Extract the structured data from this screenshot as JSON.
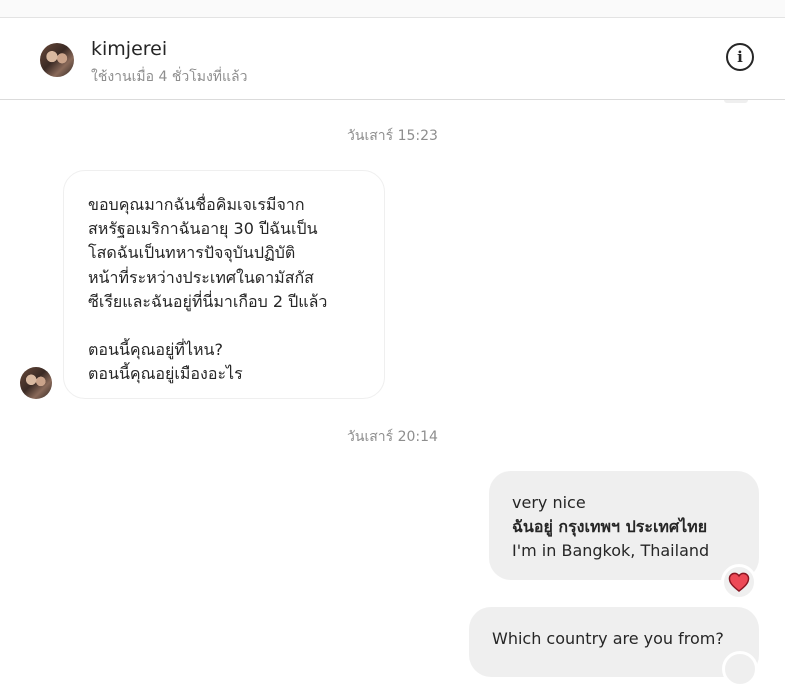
{
  "header": {
    "username": "kimjerei",
    "status": "ใช้งานเมื่อ 4 ชั่วโมงที่แล้ว",
    "info_icon": "info-icon"
  },
  "messages": {
    "timestamp1": "วันเสาร์ 15:23",
    "incoming_lines": [
      "ขอบคุณมากฉันชื่อคิมเจเรมีจาก",
      "สหรัฐอเมริกาฉันอายุ 30 ปีฉันเป็น",
      "โสดฉันเป็นทหารปัจจุบันปฏิบัติ",
      "หน้าที่ระหว่างประเทศในดามัสกัส",
      "ซีเรียและฉันอยู่ที่นี่มาเกือบ 2 ปีแล้ว",
      "",
      "ตอนนี้คุณอยู่ที่ไหน?",
      "ตอนนี้คุณอยู่เมืองอะไร"
    ],
    "timestamp2": "วันเสาร์ 20:14",
    "outgoing1": {
      "line1": "very nice",
      "line2": "ฉันอยู่ กรุงเทพฯ ประเทศไทย",
      "line3": "I'm in Bangkok, Thailand",
      "reaction": "heart-icon"
    },
    "outgoing2": {
      "text": "Which country are you from?"
    }
  },
  "colors": {
    "bubble_outgoing": "#efefef",
    "muted_text": "#8e8e8e",
    "heart": "#ed4956"
  }
}
